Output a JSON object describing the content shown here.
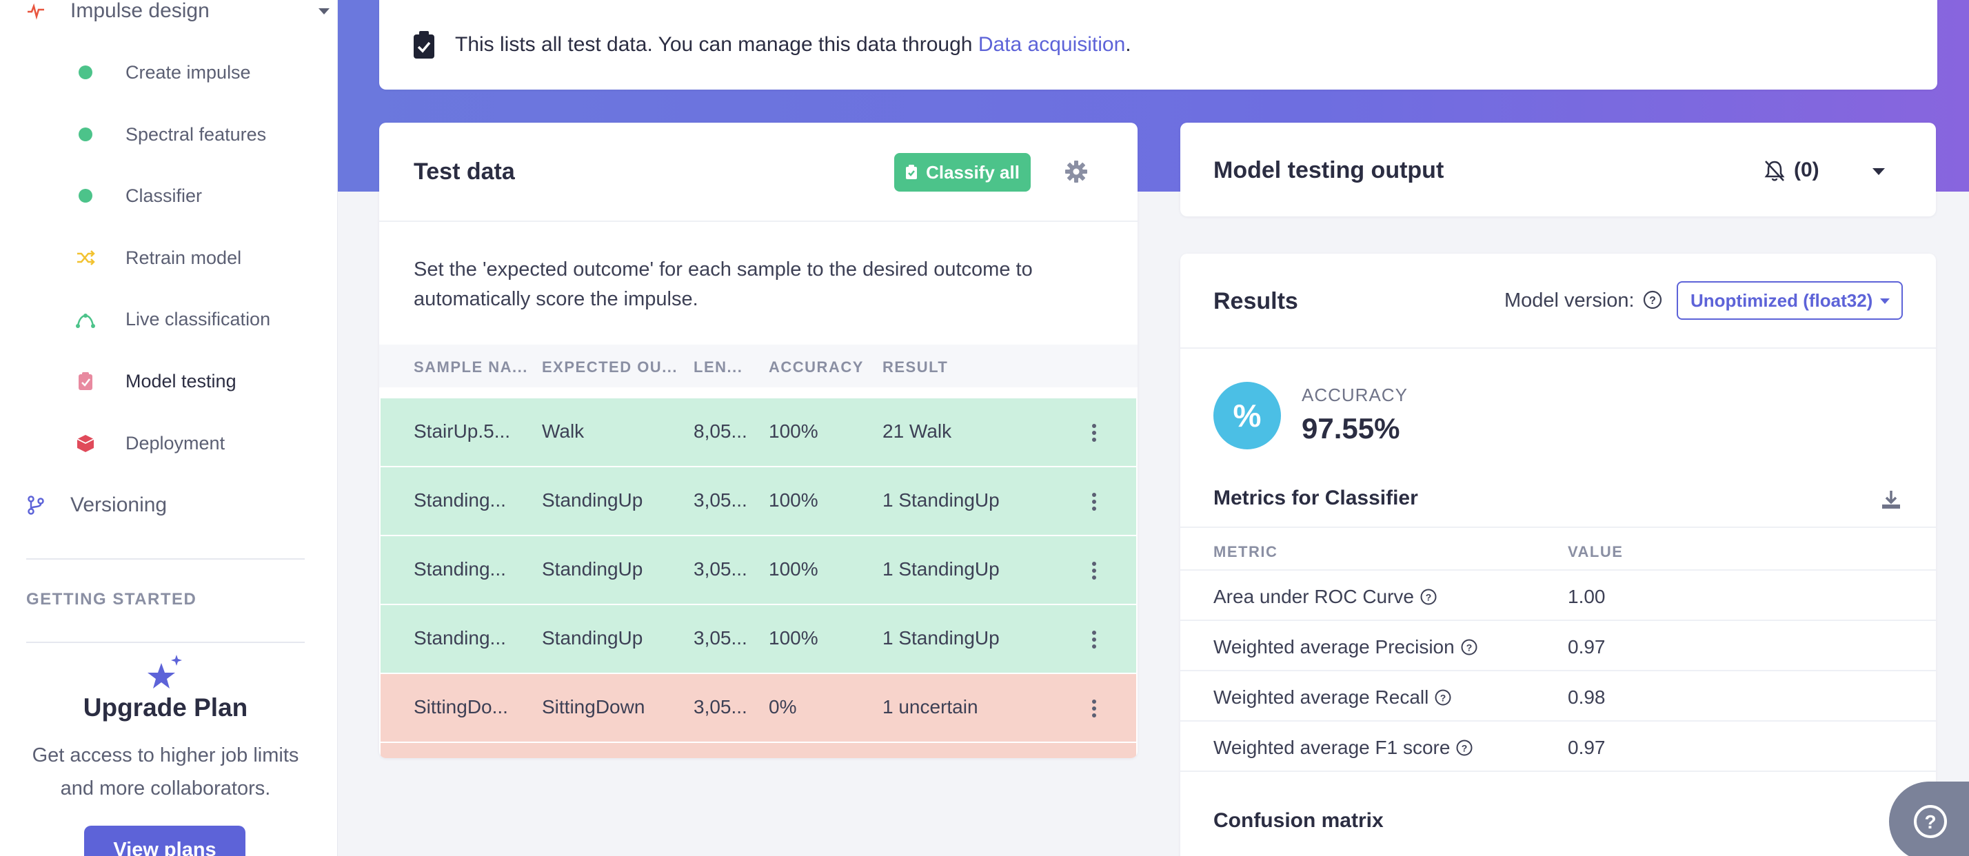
{
  "sidebar": {
    "impulse_design": "Impulse design",
    "items": [
      {
        "label": "Create impulse"
      },
      {
        "label": "Spectral features"
      },
      {
        "label": "Classifier"
      },
      {
        "label": "Retrain model"
      },
      {
        "label": "Live classification"
      },
      {
        "label": "Model testing"
      },
      {
        "label": "Deployment"
      }
    ],
    "versioning": "Versioning",
    "getting_started": "GETTING STARTED",
    "upgrade": {
      "title": "Upgrade Plan",
      "text": "Get access to higher job limits and more collaborators.",
      "button": "View plans"
    }
  },
  "notice": {
    "text": "This lists all test data. You can manage this data through ",
    "link": "Data acquisition",
    "suffix": "."
  },
  "test_data": {
    "title": "Test data",
    "classify_all": "Classify all",
    "description": "Set the 'expected outcome' for each sample to the desired outcome to automatically score the impulse.",
    "columns": [
      "SAMPLE NA...",
      "EXPECTED OU...",
      "LEN...",
      "ACCURACY",
      "RESULT"
    ],
    "rows": [
      {
        "name": "StairUp.5...",
        "expected": "Walk",
        "length": "8,05...",
        "accuracy": "100%",
        "result": "21 Walk",
        "status": "ok"
      },
      {
        "name": "Standing...",
        "expected": "StandingUp",
        "length": "3,05...",
        "accuracy": "100%",
        "result": "1 StandingUp",
        "status": "ok"
      },
      {
        "name": "Standing...",
        "expected": "StandingUp",
        "length": "3,05...",
        "accuracy": "100%",
        "result": "1 StandingUp",
        "status": "ok"
      },
      {
        "name": "Standing...",
        "expected": "StandingUp",
        "length": "3,05...",
        "accuracy": "100%",
        "result": "1 StandingUp",
        "status": "ok"
      },
      {
        "name": "SittingDo...",
        "expected": "SittingDown",
        "length": "3,05...",
        "accuracy": "0%",
        "result": "1 uncertain",
        "status": "bad"
      }
    ]
  },
  "output": {
    "title": "Model testing output",
    "count": "(0)"
  },
  "results": {
    "title": "Results",
    "model_version_label": "Model version:",
    "model_version_value": "Unoptimized (float32)",
    "accuracy_label": "ACCURACY",
    "accuracy_icon": "%",
    "accuracy_value": "97.55%",
    "metrics_title": "Metrics for Classifier",
    "metric_col": "METRIC",
    "value_col": "VALUE",
    "metrics": [
      {
        "name": "Area under ROC Curve",
        "value": "1.00"
      },
      {
        "name": "Weighted average Precision",
        "value": "0.97"
      },
      {
        "name": "Weighted average Recall",
        "value": "0.98"
      },
      {
        "name": "Weighted average F1 score",
        "value": "0.97"
      }
    ],
    "confusion_title": "Confusion matrix"
  },
  "colors": {
    "accent": "#5d63d8",
    "success": "#4cc38a",
    "row_ok": "#cdf0df",
    "row_bad": "#f7d3cb",
    "accuracy_circle": "#4bbfe5"
  }
}
